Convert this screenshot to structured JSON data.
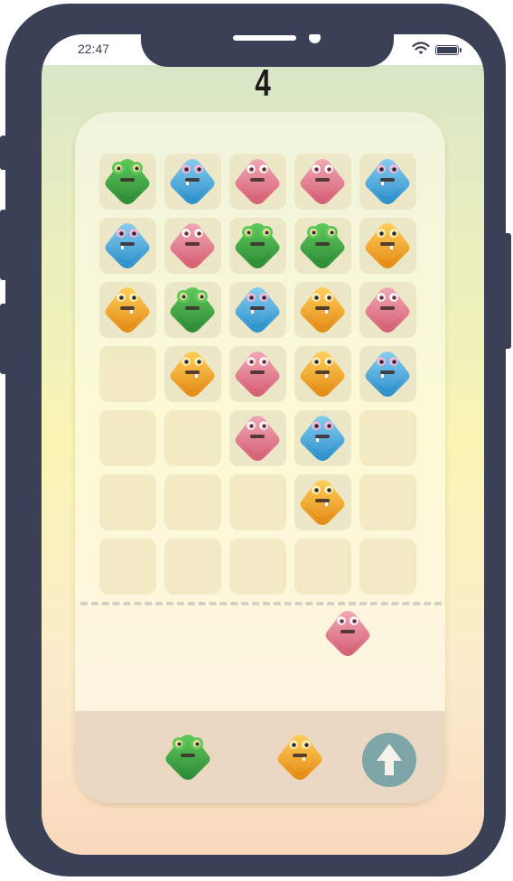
{
  "status": {
    "time": "22:47"
  },
  "score": "4",
  "colors": {
    "green": {
      "top": "#5ec85a",
      "bottom": "#2e8b37",
      "eye": "#f3e29a"
    },
    "blue": {
      "top": "#86cdf0",
      "bottom": "#2c8fca",
      "eye": "#f8b8d8"
    },
    "pink": {
      "top": "#f1a7b4",
      "bottom": "#d55f74",
      "eye": "#ffffff"
    },
    "orange": {
      "top": "#ffcf58",
      "bottom": "#e38b16",
      "eye": "#fff1b8"
    }
  },
  "grid": [
    [
      "green",
      "blue",
      "pink",
      "pink",
      "blue"
    ],
    [
      "blue",
      "pink",
      "green",
      "green",
      "orange"
    ],
    [
      "orange",
      "green",
      "blue",
      "orange",
      "pink"
    ],
    [
      "",
      "orange",
      "pink",
      "orange",
      "blue"
    ],
    [
      "",
      "",
      "pink",
      "blue",
      ""
    ],
    [
      "",
      "",
      "",
      "orange",
      ""
    ],
    [
      "",
      "",
      "",
      "",
      ""
    ]
  ],
  "falling_piece": "pink",
  "queue": [
    "green",
    "orange"
  ],
  "shoot_icon": "arrow-up-icon"
}
